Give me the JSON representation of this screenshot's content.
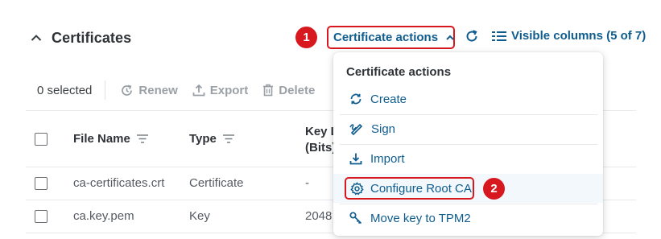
{
  "section": {
    "title": "Certificates"
  },
  "header_actions": {
    "certificate_actions_label": "Certificate actions",
    "visible_columns_label": "Visible columns (5 of 7)"
  },
  "annotations": {
    "step1": "1",
    "step2": "2"
  },
  "toolbar": {
    "selected_label": "0 selected",
    "renew_label": "Renew",
    "export_label": "Export",
    "delete_label": "Delete"
  },
  "table": {
    "columns": [
      "File Name",
      "Type",
      "Key L",
      "(Bits)"
    ],
    "rows": [
      {
        "file_name": "ca-certificates.crt",
        "type": "Certificate",
        "key_length": "-"
      },
      {
        "file_name": "ca.key.pem",
        "type": "Key",
        "key_length": "2048"
      }
    ]
  },
  "menu": {
    "title": "Certificate actions",
    "items": [
      {
        "label": "Create",
        "icon": "sync-icon"
      },
      {
        "label": "Sign",
        "icon": "signature-icon"
      },
      {
        "label": "Import",
        "icon": "download-icon"
      },
      {
        "label": "Configure Root CA",
        "icon": "gear-icon"
      },
      {
        "label": "Move key to TPM2",
        "icon": "key-icon"
      }
    ]
  },
  "colors": {
    "accent": "#0f5d8f",
    "annotation_red": "#d7191f",
    "disabled": "#9aa0a6"
  }
}
